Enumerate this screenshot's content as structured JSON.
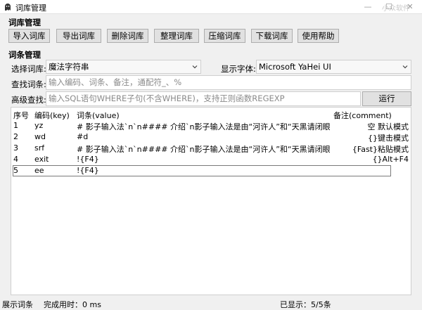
{
  "window": {
    "title": "词库管理",
    "watermark": "小众软件",
    "min": "—",
    "max": "☐",
    "close": "✕"
  },
  "library_section": {
    "title": "词库管理",
    "buttons": [
      "导入词库",
      "导出词库",
      "删除词库",
      "整理词库",
      "压缩词库",
      "下载词库",
      "使用帮助"
    ]
  },
  "entries_section": {
    "title": "词条管理",
    "select_library_label": "选择词库:",
    "select_library_value": "魔法字符串",
    "font_label": "显示字体:",
    "font_value": "Microsoft YaHei UI",
    "search_label": "查找词条:",
    "search_placeholder": "输入编码、词条、备注，通配符_、%",
    "advanced_label": "高级查找:",
    "advanced_placeholder": "输入SQL语句WHERE子句(不含WHERE)，支持正则函数REGEXP",
    "run_label": "运行"
  },
  "table": {
    "headers": [
      "序号",
      "编码(key)",
      "词条(value)",
      "备注(comment)"
    ],
    "rows": [
      {
        "no": "1",
        "key": "yz",
        "value": "# 影子输入法`n`n#### 介绍`n影子输入法是由“河许人”和“天黑请闭眼”...",
        "comment": "空 默认模式"
      },
      {
        "no": "2",
        "key": "wd",
        "value": "#d",
        "comment": "{}键击模式"
      },
      {
        "no": "3",
        "key": "srf",
        "value": "# 影子输入法`n`n#### 介绍`n影子输入法是由“河许人”和“天黑请闭眼”...",
        "comment": "{Fast}粘贴模式"
      },
      {
        "no": "4",
        "key": "exit",
        "value": "!{F4}",
        "comment": "{}Alt+F4"
      },
      {
        "no": "5",
        "key": "ee",
        "value": "!{F4}",
        "comment": ""
      }
    ]
  },
  "status": {
    "left": "展示词条",
    "time": "完成用时：0 ms",
    "shown": "已显示：5/5条"
  },
  "colors": {
    "window_bg": "#f0f0f0",
    "button_bg": "#e1e1e1",
    "button_border": "#adadad",
    "placeholder": "#8a8a8a"
  }
}
